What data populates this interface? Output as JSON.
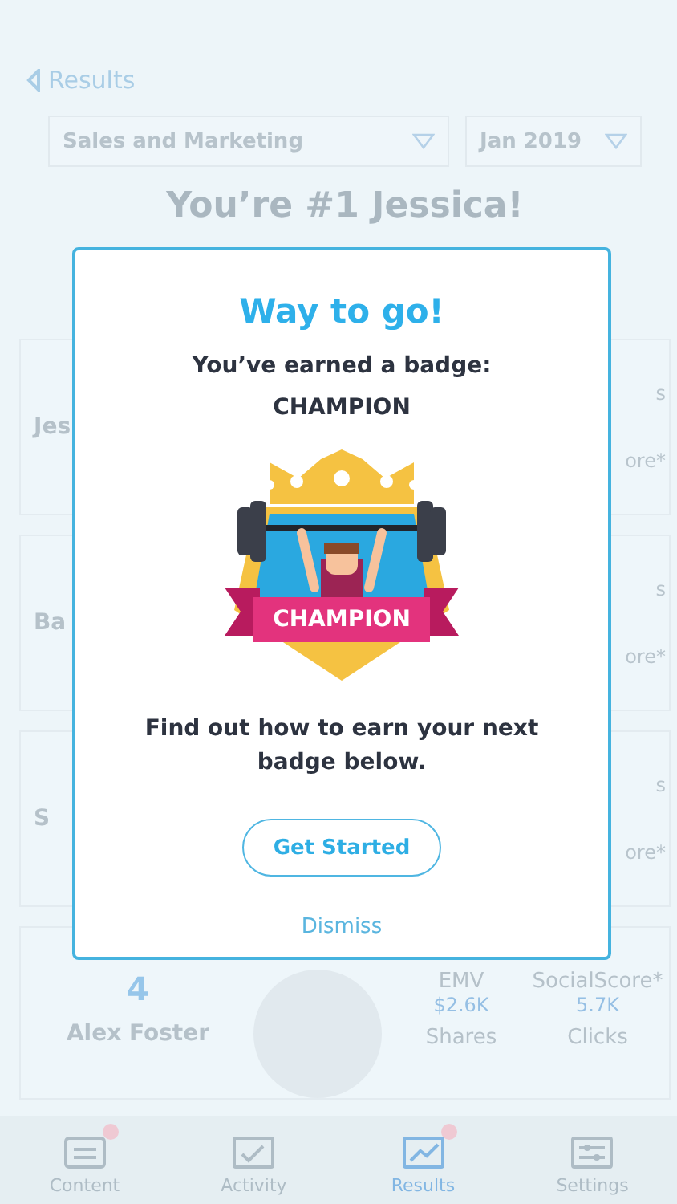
{
  "header": {
    "back_label": "Results",
    "filters": [
      {
        "label": "Sales and Marketing"
      },
      {
        "label": "Jan 2019"
      }
    ],
    "title": "You’re #1 Jessica!"
  },
  "leaderboard": [
    {
      "name": "Jes",
      "stats": [
        "s",
        "ore*"
      ]
    },
    {
      "name": "Ba",
      "stats": [
        "s",
        "ore*"
      ]
    },
    {
      "name": "S",
      "stats": [
        "s",
        "ore*"
      ]
    },
    {
      "name": "Alex Foster",
      "rank": "4",
      "stats": [
        {
          "label": "EMV",
          "value": "$2.6K"
        },
        {
          "label": "SocialScore*",
          "value": "5.7K"
        },
        {
          "label": "Shares"
        },
        {
          "label": "Clicks"
        }
      ]
    }
  ],
  "modal": {
    "title": "Way to go!",
    "subtitle": "You’ve earned a badge:",
    "badge_name": "CHAMPION",
    "ribbon_text": "CHAMPION",
    "message": "Find out how to earn your next badge below.",
    "primary_button": "Get Started",
    "dismiss": "Dismiss"
  },
  "tab_bar": [
    {
      "label": "Content",
      "kind": "content",
      "selected": false,
      "badge": true
    },
    {
      "label": "Activity",
      "kind": "activity",
      "selected": false,
      "badge": false
    },
    {
      "label": "Results",
      "kind": "results",
      "selected": true,
      "badge": true
    },
    {
      "label": "Settings",
      "kind": "settings",
      "selected": false,
      "badge": false
    }
  ]
}
